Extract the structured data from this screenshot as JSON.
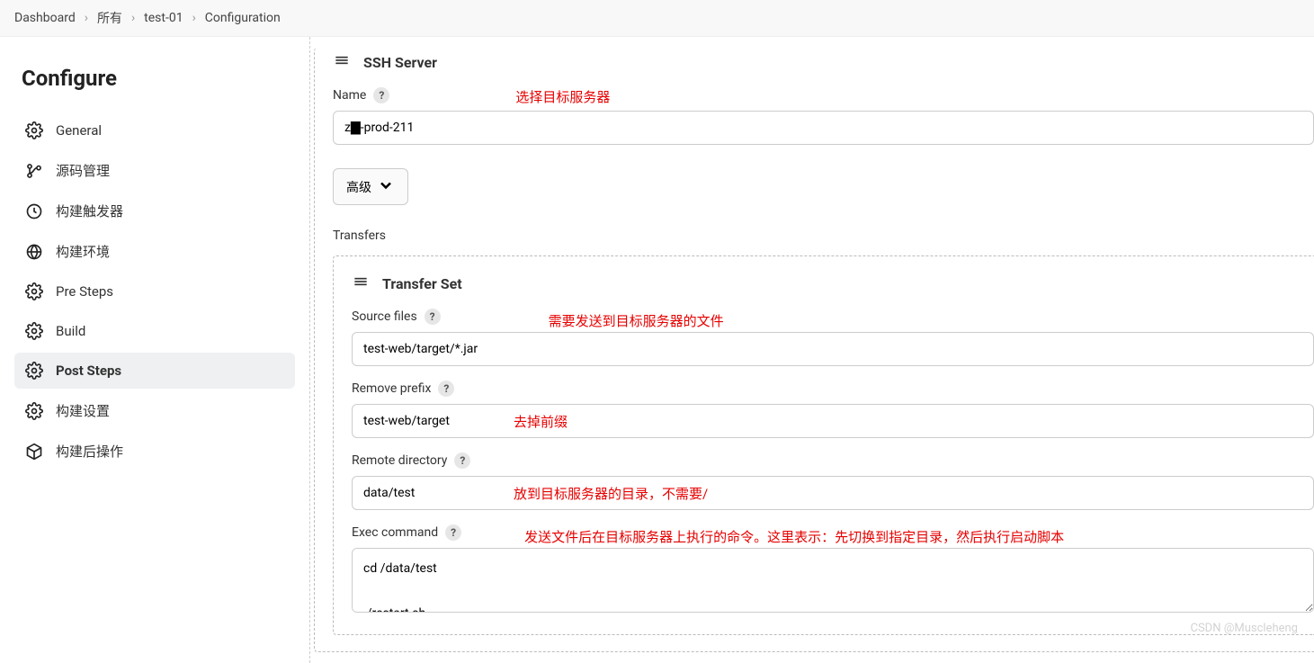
{
  "breadcrumb": [
    "Dashboard",
    "所有",
    "test-01",
    "Configuration"
  ],
  "sidebar": {
    "title": "Configure",
    "items": [
      {
        "label": "General"
      },
      {
        "label": "源码管理"
      },
      {
        "label": "构建触发器"
      },
      {
        "label": "构建环境"
      },
      {
        "label": "Pre Steps"
      },
      {
        "label": "Build"
      },
      {
        "label": "Post Steps"
      },
      {
        "label": "构建设置"
      },
      {
        "label": "构建后操作"
      }
    ]
  },
  "ssh": {
    "title": "SSH Server",
    "name_label": "Name",
    "name_value": "z▇-prod-211",
    "name_annotation": "选择目标服务器",
    "advanced_label": "高级",
    "transfers_label": "Transfers",
    "transfer_set_title": "Transfer Set",
    "source_label": "Source files",
    "source_value": "test-web/target/*.jar",
    "source_annotation": "需要发送到目标服务器的文件",
    "remove_prefix_label": "Remove prefix",
    "remove_prefix_value": "test-web/target",
    "remove_prefix_annotation": "去掉前缀",
    "remote_dir_label": "Remote directory",
    "remote_dir_value": "data/test",
    "remote_dir_annotation": "放到目标服务器的目录，不需要/",
    "exec_label": "Exec command",
    "exec_value": "cd /data/test\n\n./restart.sh",
    "exec_annotation": "发送文件后在目标服务器上执行的命令。这里表示：先切换到指定目录，然后执行启动脚本"
  },
  "watermark": "CSDN @Muscleheng"
}
